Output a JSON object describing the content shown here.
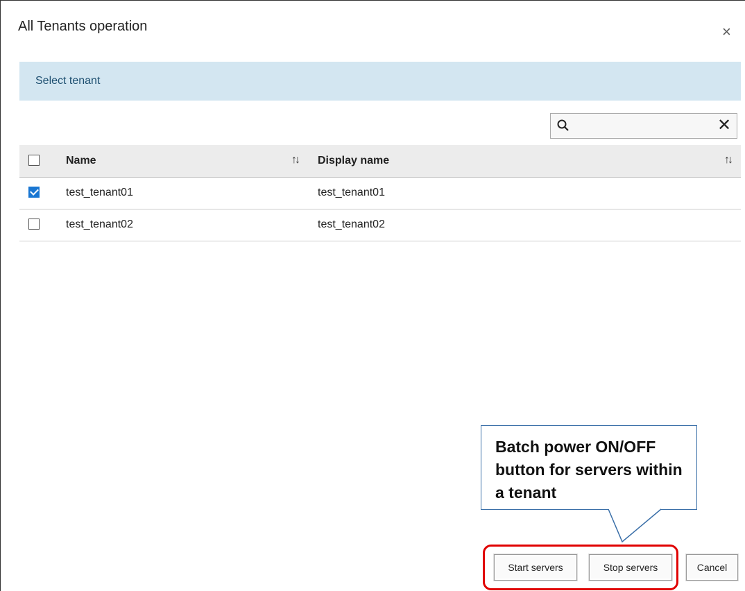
{
  "dialog": {
    "title": "All Tenants operation",
    "close_symbol": "×"
  },
  "banner": {
    "text": "Select tenant"
  },
  "search": {
    "icon": "search-icon",
    "value": "",
    "placeholder": "",
    "clear_symbol": "✕"
  },
  "table": {
    "columns": [
      {
        "label": "Name",
        "sort_icon": "sort-icon"
      },
      {
        "label": "Display name",
        "sort_icon": "sort-icon"
      }
    ],
    "select_all_checked": false,
    "rows": [
      {
        "checked": true,
        "name": "test_tenant01",
        "display_name": "test_tenant01"
      },
      {
        "checked": false,
        "name": "test_tenant02",
        "display_name": "test_tenant02"
      }
    ]
  },
  "callout": {
    "text": "Batch power ON/OFF button for servers within a tenant"
  },
  "buttons": {
    "start": "Start servers",
    "stop": "Stop servers",
    "cancel": "Cancel"
  },
  "colors": {
    "banner_bg": "#d3e6f1",
    "banner_text": "#1d4f70",
    "checkbox_checked": "#1976d2",
    "highlight_border": "#e00000",
    "callout_border": "#3a6fa8"
  }
}
